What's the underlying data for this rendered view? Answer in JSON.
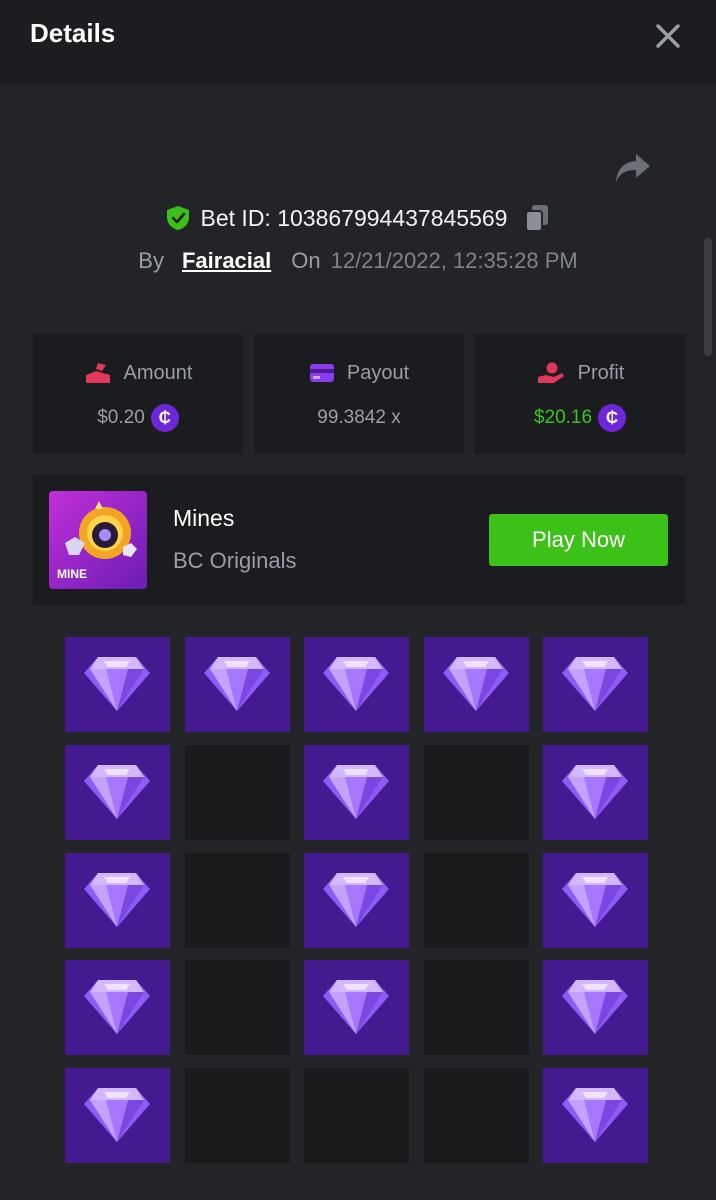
{
  "header": {
    "title": "Details"
  },
  "bet": {
    "id_label": "Bet ID: 103867994437845569",
    "by_label": "By",
    "user": "Fairacial",
    "on_label": "On",
    "datetime": "12/21/2022, 12:35:28 PM"
  },
  "stats": [
    {
      "label": "Amount",
      "value": "$0.20",
      "icon": "amount-icon",
      "has_coin": true
    },
    {
      "label": "Payout",
      "value": "99.3842 x",
      "icon": "payout-card-icon",
      "has_coin": false
    },
    {
      "label": "Profit",
      "value": "$20.16",
      "icon": "profit-hand-icon",
      "has_coin": true
    }
  ],
  "coin_symbol": "₵",
  "game": {
    "thumb_label": "MINE",
    "name": "Mines",
    "provider": "BC Originals",
    "play_label": "Play Now"
  },
  "board": {
    "rows": 5,
    "cols": 5,
    "cells": [
      "gem",
      "gem",
      "gem",
      "gem",
      "gem",
      "gem",
      "empty",
      "gem",
      "empty",
      "gem",
      "gem",
      "empty",
      "gem",
      "empty",
      "gem",
      "gem",
      "empty",
      "gem",
      "empty",
      "gem",
      "gem",
      "empty",
      "empty",
      "empty",
      "gem"
    ]
  },
  "colors": {
    "accent_green": "#3bc117",
    "profit_green": "#3dc31f",
    "gem_tile": "#431a8f",
    "empty_tile": "#1a1b1d",
    "coin": "#6e26d9"
  }
}
